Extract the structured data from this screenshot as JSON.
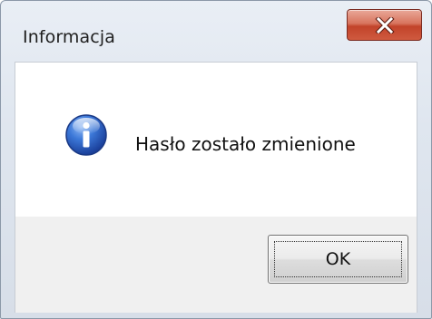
{
  "dialog": {
    "title": "Informacja",
    "message": "Hasło zostało zmienione",
    "ok_label": "OK",
    "icon": "info-icon"
  },
  "colors": {
    "close_button": "#c9492f",
    "client_background": "#f0f0f0",
    "message_background": "#ffffff"
  }
}
